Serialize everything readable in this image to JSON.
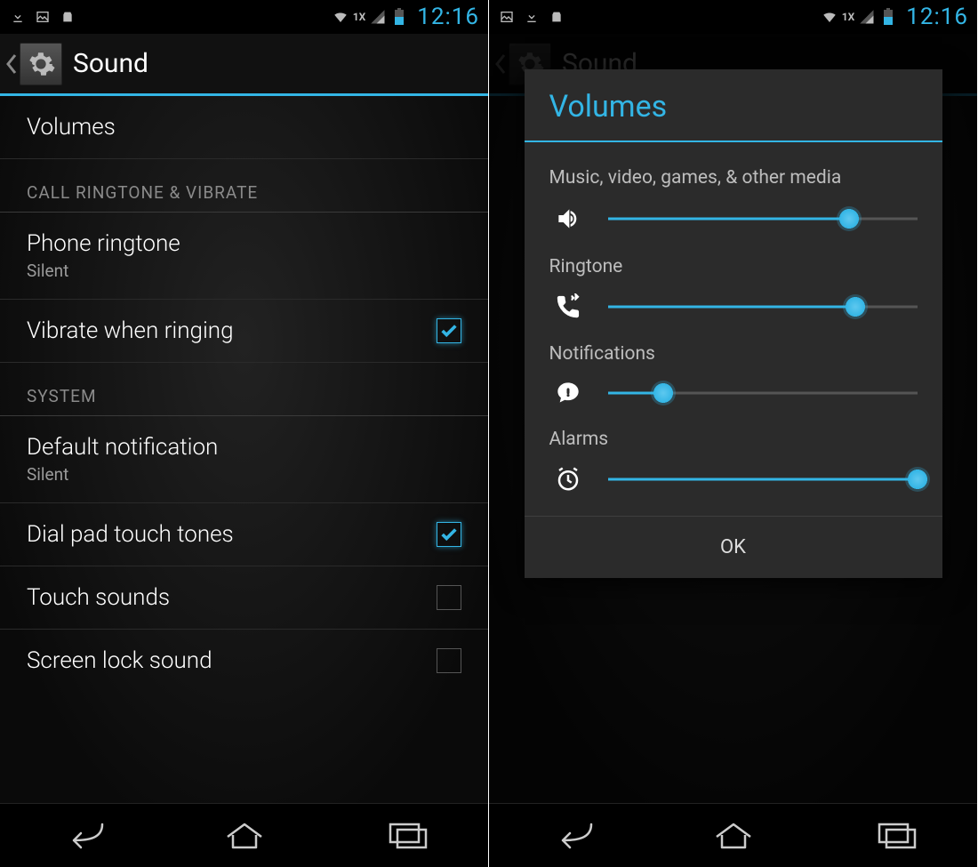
{
  "status": {
    "time": "12:16",
    "network_label": "1X"
  },
  "actionbar": {
    "title": "Sound"
  },
  "list": {
    "volumes": "Volumes",
    "section_ringtone": "CALL RINGTONE & VIBRATE",
    "phone_ringtone": {
      "title": "Phone ringtone",
      "value": "Silent"
    },
    "vibrate": {
      "title": "Vibrate when ringing",
      "checked": true
    },
    "section_system": "SYSTEM",
    "default_notification": {
      "title": "Default notification",
      "value": "Silent"
    },
    "dialpad": {
      "title": "Dial pad touch tones",
      "checked": true
    },
    "touch_sounds": {
      "title": "Touch sounds",
      "checked": false
    },
    "screen_lock_sound": {
      "title": "Screen lock sound",
      "checked": false
    }
  },
  "dialog": {
    "title": "Volumes",
    "ok": "OK",
    "sliders": {
      "media": {
        "label": "Music, video, games, & other media",
        "percent": 78
      },
      "ringtone": {
        "label": "Ringtone",
        "percent": 80
      },
      "notifications": {
        "label": "Notifications",
        "percent": 18
      },
      "alarms": {
        "label": "Alarms",
        "percent": 100
      }
    }
  }
}
